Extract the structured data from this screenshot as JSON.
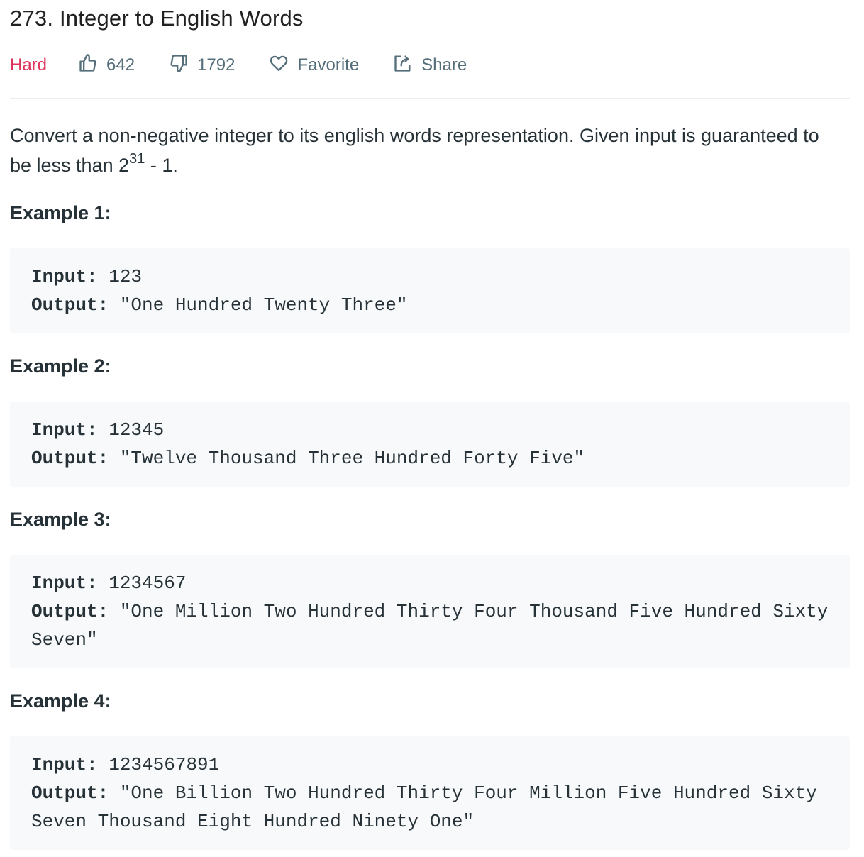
{
  "problem": {
    "title": "273. Integer to English Words",
    "difficulty": "Hard",
    "likes": "642",
    "dislikes": "1792",
    "favorite_label": "Favorite",
    "share_label": "Share"
  },
  "description": {
    "text_before": "Convert a non-negative integer to its english words representation. Given input is guaranteed to be less than 2",
    "superscript": "31",
    "text_after": " - 1."
  },
  "examples": [
    {
      "heading": "Example 1:",
      "input_label": "Input:",
      "input_value": " 123",
      "output_label": "Output:",
      "output_value": " \"One Hundred Twenty Three\""
    },
    {
      "heading": "Example 2:",
      "input_label": "Input:",
      "input_value": " 12345",
      "output_label": "Output:",
      "output_value": " \"Twelve Thousand Three Hundred Forty Five\""
    },
    {
      "heading": "Example 3:",
      "input_label": "Input:",
      "input_value": " 1234567",
      "output_label": "Output:",
      "output_value": " \"One Million Two Hundred Thirty Four Thousand Five Hundred Sixty Seven\""
    },
    {
      "heading": "Example 4:",
      "input_label": "Input:",
      "input_value": " 1234567891",
      "output_label": "Output:",
      "output_value": " \"One Billion Two Hundred Thirty Four Million Five Hundred Sixty Seven Thousand Eight Hundred Ninety One\""
    }
  ],
  "icons": {
    "like": "thumbs-up-icon",
    "dislike": "thumbs-down-icon",
    "favorite": "heart-icon",
    "share": "share-icon"
  },
  "colors": {
    "difficulty_hard": "#e0335b",
    "meta_text": "#546e7a",
    "code_bg": "#f7f9fa",
    "divider": "#eceff1"
  }
}
